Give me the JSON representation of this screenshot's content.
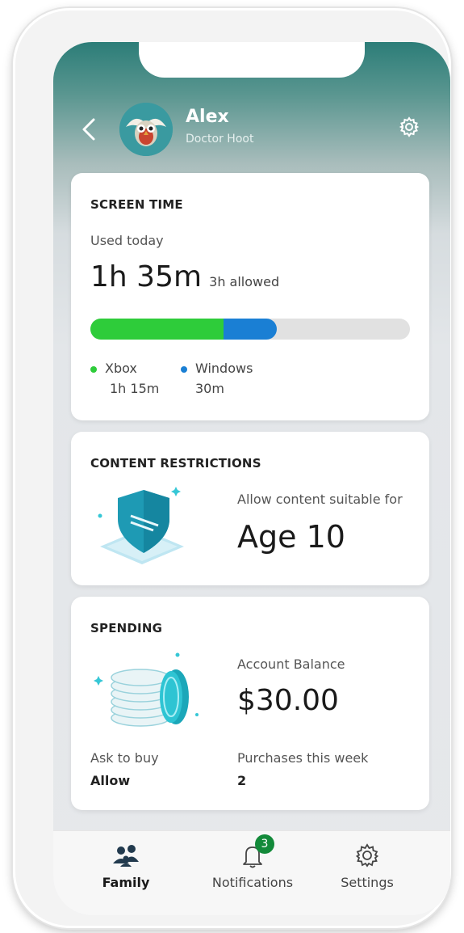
{
  "header": {
    "back_label": "<",
    "name": "Alex",
    "gamertag": "Doctor Hoot",
    "avatar_icon": "owl-avatar",
    "settings_icon": "gear-icon"
  },
  "screen_time": {
    "title": "SCREEN TIME",
    "used_label": "Used today",
    "used_value": "1h 35m",
    "allowed_label": "3h allowed",
    "progress": {
      "xbox_minutes": 75,
      "windows_minutes": 30,
      "allowed_minutes": 180
    },
    "colors": {
      "xbox": "#2ecc3a",
      "windows": "#1a7fd4",
      "track": "#e1e1e1"
    },
    "legend": [
      {
        "name": "Xbox",
        "time": "1h 15m"
      },
      {
        "name": "Windows",
        "time": "30m"
      }
    ]
  },
  "content": {
    "title": "CONTENT RESTRICTIONS",
    "subtitle": "Allow content suitable for",
    "age": "Age 10",
    "icon": "shield-icon"
  },
  "spending": {
    "title": "SPENDING",
    "balance_label": "Account Balance",
    "balance": "$30.00",
    "ask_label": "Ask to buy",
    "ask_value": "Allow",
    "purchases_label": "Purchases this week",
    "purchases_value": "2",
    "icon": "coins-icon"
  },
  "nav": {
    "family": "Family",
    "notifications": "Notifications",
    "notifications_badge": "3",
    "settings": "Settings"
  }
}
